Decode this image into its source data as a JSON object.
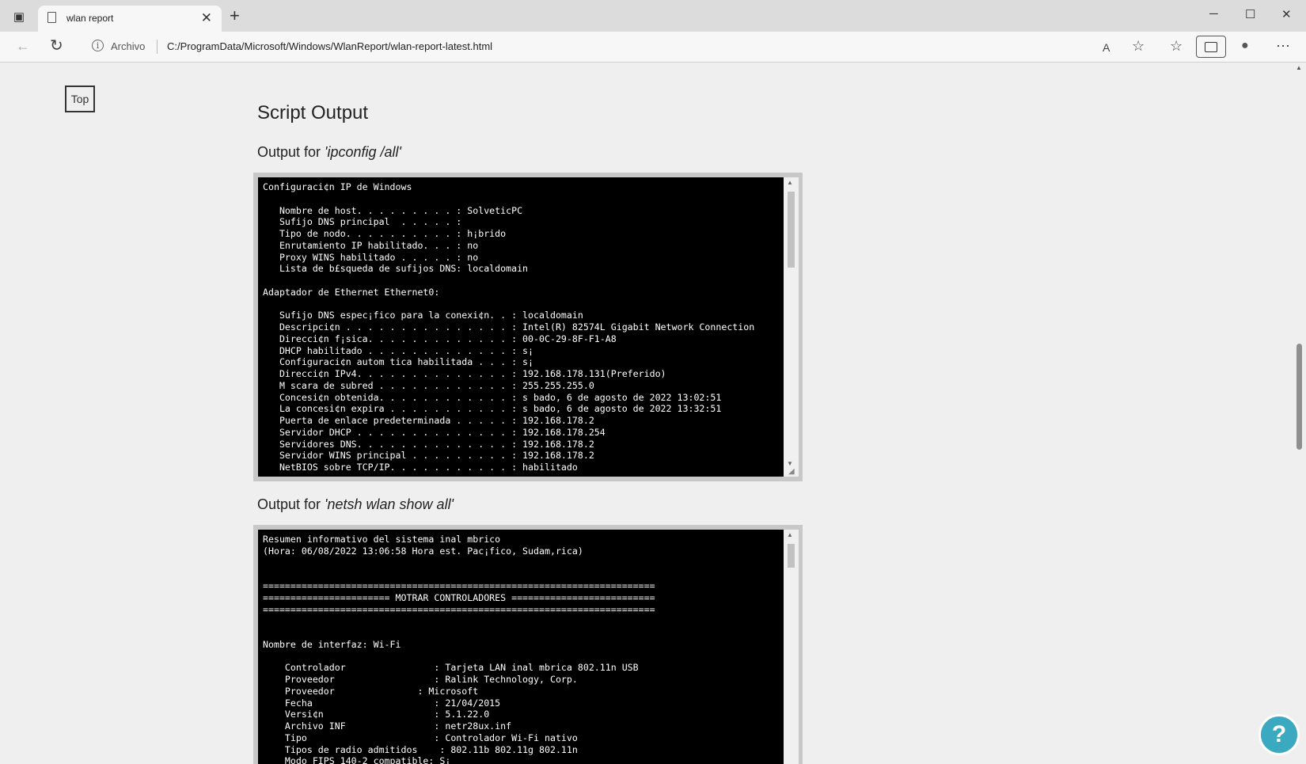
{
  "browser": {
    "tab_title": "wlan report",
    "tab_close": "✕",
    "new_tab": "+",
    "archivo_label": "Archivo",
    "url": "C:/ProgramData/Microsoft/Windows/WlanReport/wlan-report-latest.html",
    "window_buttons": {
      "minimize": "─",
      "maximize": "☐",
      "close": "✕"
    },
    "toolbar_icons": {
      "back": "←",
      "refresh": "↻",
      "read_aloud": "A",
      "favorite": "☆",
      "favorites": "☆",
      "profile": "●",
      "more": "⋯",
      "info": "i"
    }
  },
  "page": {
    "top_button": "Top",
    "heading": "Script Output",
    "sections": [
      {
        "prefix": "Output for ",
        "command": "'ipconfig /all'",
        "output": "Configuraci¢n IP de Windows\n\n   Nombre de host. . . . . . . . . : SolveticPC\n   Sufijo DNS principal  . . . . . :\n   Tipo de nodo. . . . . . . . . . : h¡brido\n   Enrutamiento IP habilitado. . . : no\n   Proxy WINS habilitado . . . . . : no\n   Lista de b£squeda de sufijos DNS: localdomain\n\nAdaptador de Ethernet Ethernet0:\n\n   Sufijo DNS espec¡fico para la conexi¢n. . : localdomain\n   Descripci¢n . . . . . . . . . . . . . . . : Intel(R) 82574L Gigabit Network Connection\n   Direcci¢n f¡sica. . . . . . . . . . . . . : 00-0C-29-8F-F1-A8\n   DHCP habilitado . . . . . . . . . . . . . : s¡\n   Configuraci¢n autom tica habilitada . . . : s¡\n   Direcci¢n IPv4. . . . . . . . . . . . . . : 192.168.178.131(Preferido)\n   M scara de subred . . . . . . . . . . . . : 255.255.255.0\n   Concesi¢n obtenida. . . . . . . . . . . . : s bado, 6 de agosto de 2022 13:02:51\n   La concesi¢n expira . . . . . . . . . . . : s bado, 6 de agosto de 2022 13:32:51\n   Puerta de enlace predeterminada . . . . . : 192.168.178.2\n   Servidor DHCP . . . . . . . . . . . . . . : 192.168.178.254\n   Servidores DNS. . . . . . . . . . . . . . : 192.168.178.2\n   Servidor WINS principal . . . . . . . . . : 192.168.178.2\n   NetBIOS sobre TCP/IP. . . . . . . . . . . : habilitado"
      },
      {
        "prefix": "Output for ",
        "command": "'netsh wlan show all'",
        "output": "Resumen informativo del sistema inal mbrico\n(Hora: 06/08/2022 13:06:58 Hora est. Pac¡fico, Sudam,rica)\n\n\n=======================================================================\n======================= MOTRAR CONTROLADORES ==========================\n=======================================================================\n\n\nNombre de interfaz: Wi-Fi\n\n    Controlador                : Tarjeta LAN inal mbrica 802.11n USB\n    Proveedor                  : Ralink Technology, Corp.\n    Proveedor               : Microsoft\n    Fecha                      : 21/04/2015\n    Versi¢n                    : 5.1.22.0\n    Archivo INF                : netr28ux.inf\n    Tipo                       : Controlador Wi-Fi nativo\n    Tipos de radio admitidos    : 802.11b 802.11g 802.11n\n    Modo FIPS 140-2 compatible: S¡"
      }
    ]
  },
  "helper_badge": "?"
}
